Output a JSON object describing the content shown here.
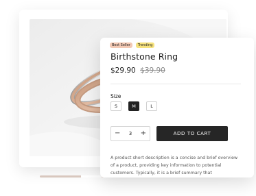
{
  "product": {
    "badges": {
      "bestseller": "Best Seller",
      "trending": "Trending"
    },
    "title": "Birthstone Ring",
    "price_sale": "$29.90",
    "price_original": "$39.90",
    "size_label": "Size",
    "sizes": [
      "S",
      "M",
      "L"
    ],
    "selected_size": "M",
    "quantity": "3",
    "qty_minus_icon": "minus-icon",
    "qty_plus_icon": "plus-icon",
    "add_to_cart_label": "ADD TO CART",
    "description": "A product short description is a concise and brief overview of a product, providing key information to potential customers. Typically, it is a brief summary that"
  },
  "colors": {
    "badge_bestseller": "#f3c9b4",
    "badge_trending": "#f6e27d",
    "button_dark": "#262626"
  }
}
